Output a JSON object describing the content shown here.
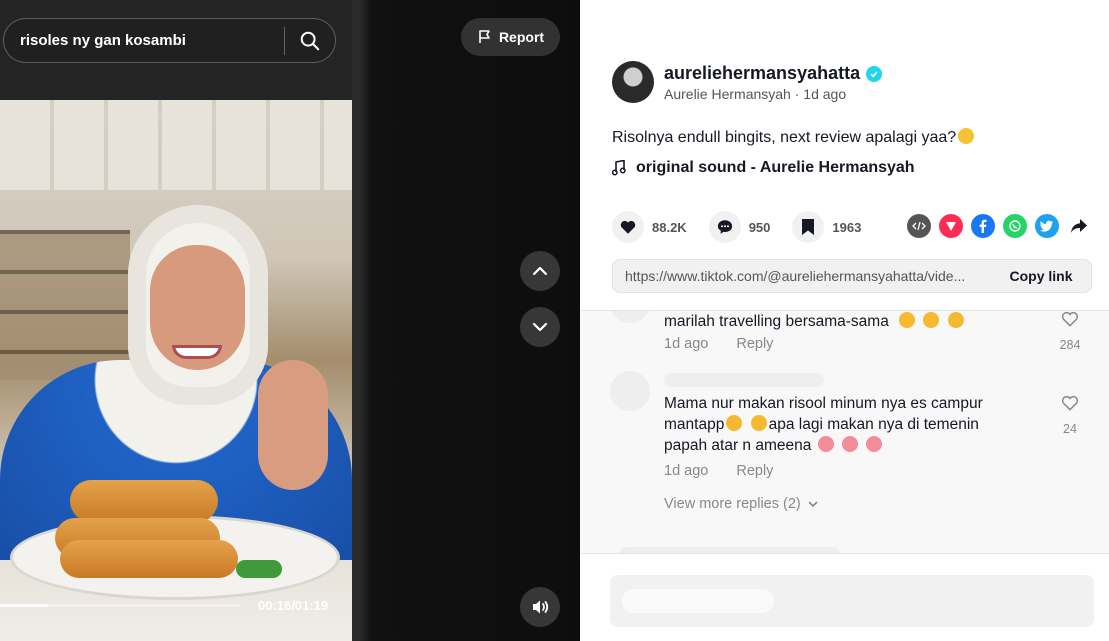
{
  "search": {
    "query": "risoles ny gan kosambi"
  },
  "video": {
    "report_label": "Report",
    "time": "00:16/01:19",
    "progress": 0.2
  },
  "author": {
    "username": "aureliehermansyahatta",
    "display_name": "Aurelie Hermansyah",
    "posted": "1d ago",
    "verified_color": "#20d5ec"
  },
  "post": {
    "caption": "Risolnya endull bingits, next review apalagi yaa?",
    "caption_emoji": "face-with-hand-over-mouth",
    "sound": "original sound - Aurelie Hermansyah"
  },
  "stats": {
    "likes": "88.2K",
    "comments": "950",
    "saves": "1963"
  },
  "share_icons": [
    "embed-icon",
    "send-icon",
    "facebook-icon",
    "whatsapp-icon",
    "twitter-icon",
    "share-arrow-icon"
  ],
  "colors": {
    "facebook": "#1877f2",
    "whatsapp": "#25d366",
    "twitter": "#1da1f2",
    "send": "#fe2c55",
    "embed": "#555555"
  },
  "link": {
    "url": "https://www.tiktok.com/@aureliehermansyahatta/vide...",
    "copy_label": "Copy link"
  },
  "comments": [
    {
      "text": "marilah travelling bersama-sama",
      "emojis": [
        "rolling-laughing",
        "rolling-laughing",
        "rolling-laughing"
      ],
      "time": "1d ago",
      "reply_label": "Reply",
      "likes": "284"
    },
    {
      "text_line1": "Mama nur makan risool minum nya es campur",
      "text_line2_pre": "mantapp",
      "text_line2_post": "apa lagi makan nya di temenin",
      "text_line3": "papah atar n ameena",
      "time": "1d ago",
      "reply_label": "Reply",
      "likes": "24"
    }
  ],
  "view_more_replies": "View more replies (2)"
}
